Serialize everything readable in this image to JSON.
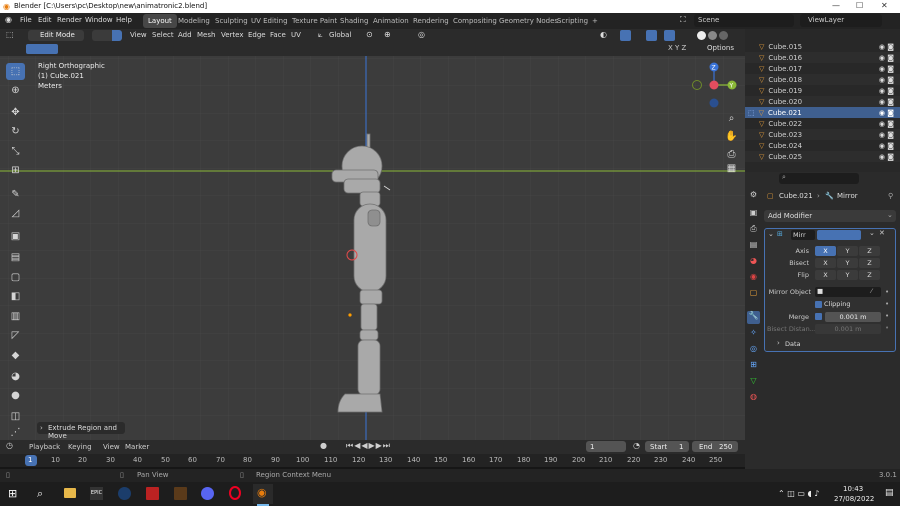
{
  "window": {
    "title": "Blender [C:\\Users\\pc\\Desktop\\new\\animatronic2.blend]",
    "minimize": "—",
    "maximize": "☐",
    "close": "✕"
  },
  "menu": [
    "File",
    "Edit",
    "Render",
    "Window",
    "Help"
  ],
  "workspaces": [
    "Layout",
    "Modeling",
    "Sculpting",
    "UV Editing",
    "Texture Paint",
    "Shading",
    "Animation",
    "Rendering",
    "Compositing",
    "Geometry Nodes",
    "Scripting",
    "+"
  ],
  "scene": {
    "name": "Scene",
    "view_layer": "ViewLayer"
  },
  "header3d": {
    "mode": "Edit Mode",
    "menus": [
      "View",
      "Select",
      "Add",
      "Mesh",
      "Vertex",
      "Edge",
      "Face",
      "UV"
    ],
    "orientation": "Global",
    "options": "Options"
  },
  "overlay_text": {
    "view": "Right Orthographic",
    "object": "(1) Cube.021",
    "units": "Meters"
  },
  "gizmo": {
    "z": "Z",
    "y": "Y"
  },
  "operator_panel": "Extrude Region and Move",
  "outliner": [
    {
      "name": "Cube.015",
      "selected": false
    },
    {
      "name": "Cube.016",
      "selected": false
    },
    {
      "name": "Cube.017",
      "selected": false
    },
    {
      "name": "Cube.018",
      "selected": false
    },
    {
      "name": "Cube.019",
      "selected": false
    },
    {
      "name": "Cube.020",
      "selected": false
    },
    {
      "name": "Cube.021",
      "selected": true
    },
    {
      "name": "Cube.022",
      "selected": false
    },
    {
      "name": "Cube.023",
      "selected": false
    },
    {
      "name": "Cube.024",
      "selected": false
    },
    {
      "name": "Cube.025",
      "selected": false
    }
  ],
  "properties": {
    "object": "Cube.021",
    "modifier_type": "Mirror",
    "add_modifier": "Add Modifier",
    "modifier_name": "Mirr",
    "axis_label": "Axis",
    "bisect_label": "Bisect",
    "flip_label": "Flip",
    "x": "X",
    "y": "Y",
    "z": "Z",
    "mirror_object_label": "Mirror Object",
    "clipping_label": "Clipping",
    "merge_label": "Merge",
    "merge_value": "0.001 m",
    "bisect_distance_label": "Bisect Distan...",
    "bisect_distance_value": "0.001 m",
    "data_label": "Data"
  },
  "timeline": {
    "menus": [
      "Playback",
      "Keying",
      "View",
      "Marker"
    ],
    "current_frame": "1",
    "start_label": "Start",
    "start": "1",
    "end_label": "End",
    "end": "250"
  },
  "ruler": [
    "1",
    "10",
    "20",
    "30",
    "40",
    "50",
    "60",
    "70",
    "80",
    "90",
    "100",
    "110",
    "120",
    "130",
    "140",
    "150",
    "160",
    "170",
    "180",
    "190",
    "200",
    "210",
    "220",
    "230",
    "240",
    "250"
  ],
  "statusbar": {
    "left1": "Pan View",
    "left2": "Region Context Menu",
    "version": "3.0.1"
  },
  "taskbar": {
    "time": "10:43",
    "date": "27/08/2022"
  },
  "colors": {
    "accent": "#4772b3",
    "x_axis": "#e54d5f",
    "y_axis": "#8ab837",
    "z_axis": "#3a73d6",
    "mesh": "#a9a9a9"
  }
}
